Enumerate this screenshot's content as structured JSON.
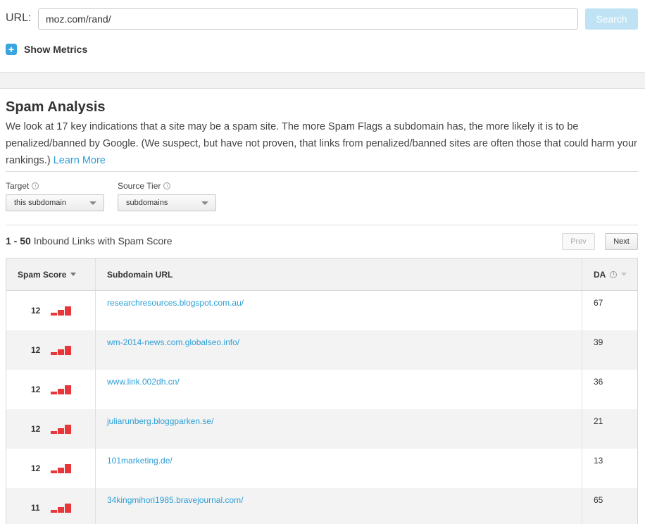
{
  "url_bar": {
    "label": "URL:",
    "value": "moz.com/rand/",
    "search_label": "Search"
  },
  "show_metrics": {
    "label": "Show Metrics",
    "icon": "plus-icon"
  },
  "spam_analysis": {
    "title": "Spam Analysis",
    "description": "We look at 17 key indications that a site may be a spam site. The more Spam Flags a subdomain has, the more likely it is to be penalized/banned by Google. (We suspect, but have not proven, that links from penalized/banned sites are often those that could harm your rankings.) ",
    "learn_more": "Learn More"
  },
  "filters": {
    "target": {
      "label": "Target",
      "value": "this subdomain"
    },
    "source_tier": {
      "label": "Source Tier",
      "value": "subdomains"
    }
  },
  "results": {
    "range": "1 - 50",
    "suffix": " Inbound Links with Spam Score",
    "prev": "Prev",
    "next": "Next"
  },
  "table": {
    "headers": {
      "spam_score": "Spam Score",
      "subdomain_url": "Subdomain URL",
      "da": "DA"
    },
    "rows": [
      {
        "score": "12",
        "url": "researchresources.blogspot.com.au/",
        "da": "67"
      },
      {
        "score": "12",
        "url": "wm-2014-news.com.globalseo.info/",
        "da": "39"
      },
      {
        "score": "12",
        "url": "www.link.002dh.cn/",
        "da": "36"
      },
      {
        "score": "12",
        "url": "juliarunberg.bloggparken.se/",
        "da": "21"
      },
      {
        "score": "12",
        "url": "101marketing.de/",
        "da": "13"
      },
      {
        "score": "11",
        "url": "34kingmihori1985.bravejournal.com/",
        "da": "65"
      }
    ]
  },
  "colors": {
    "accent": "#2e9fd6",
    "search_button": "#bfe3f5",
    "spam_bars": "#e8373a"
  }
}
